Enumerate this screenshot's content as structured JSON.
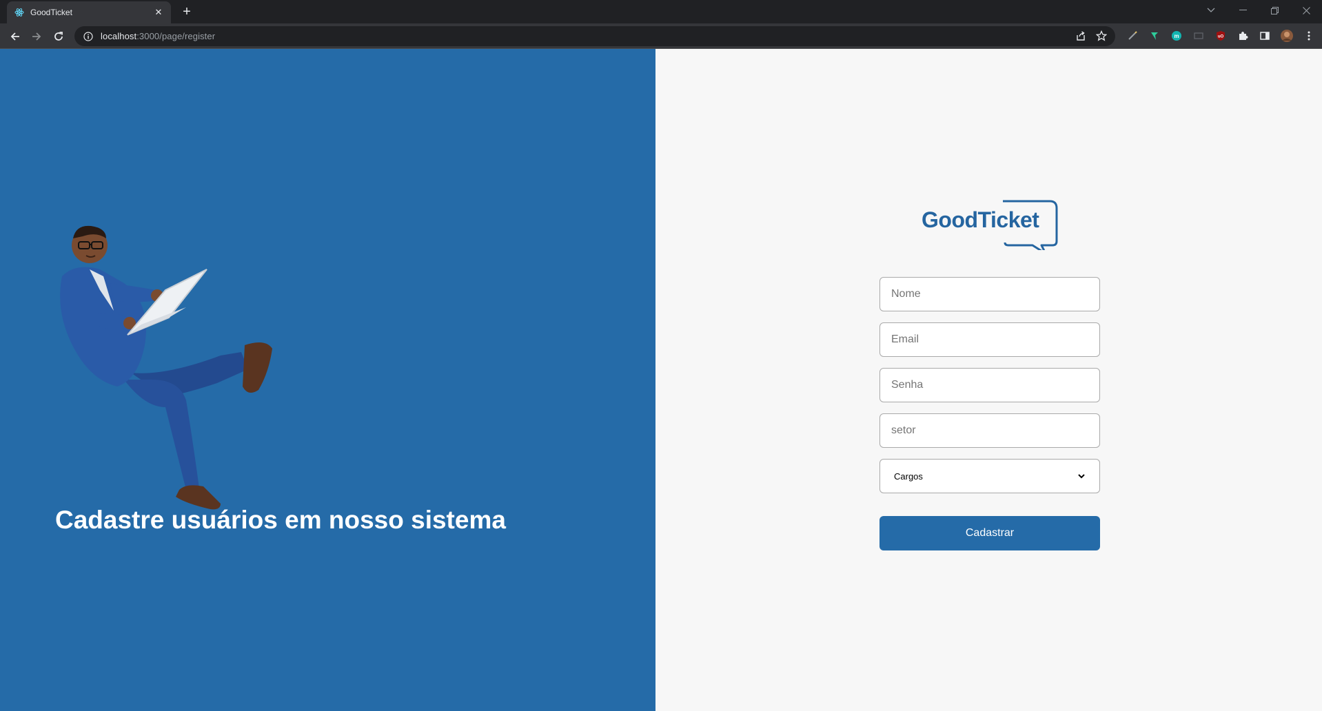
{
  "browser": {
    "tab_title": "GoodTicket",
    "url_host": "localhost",
    "url_rest": ":3000/page/register"
  },
  "left": {
    "heading": "Cadastre usuários em nosso sistema",
    "accent_color": "#256ba8"
  },
  "logo": {
    "text": "GoodTicket",
    "color": "#2565a0"
  },
  "form": {
    "name_placeholder": "Nome",
    "email_placeholder": "Email",
    "password_placeholder": "Senha",
    "sector_placeholder": "setor",
    "role_selected": "Cargos",
    "submit_label": "Cadastrar"
  }
}
